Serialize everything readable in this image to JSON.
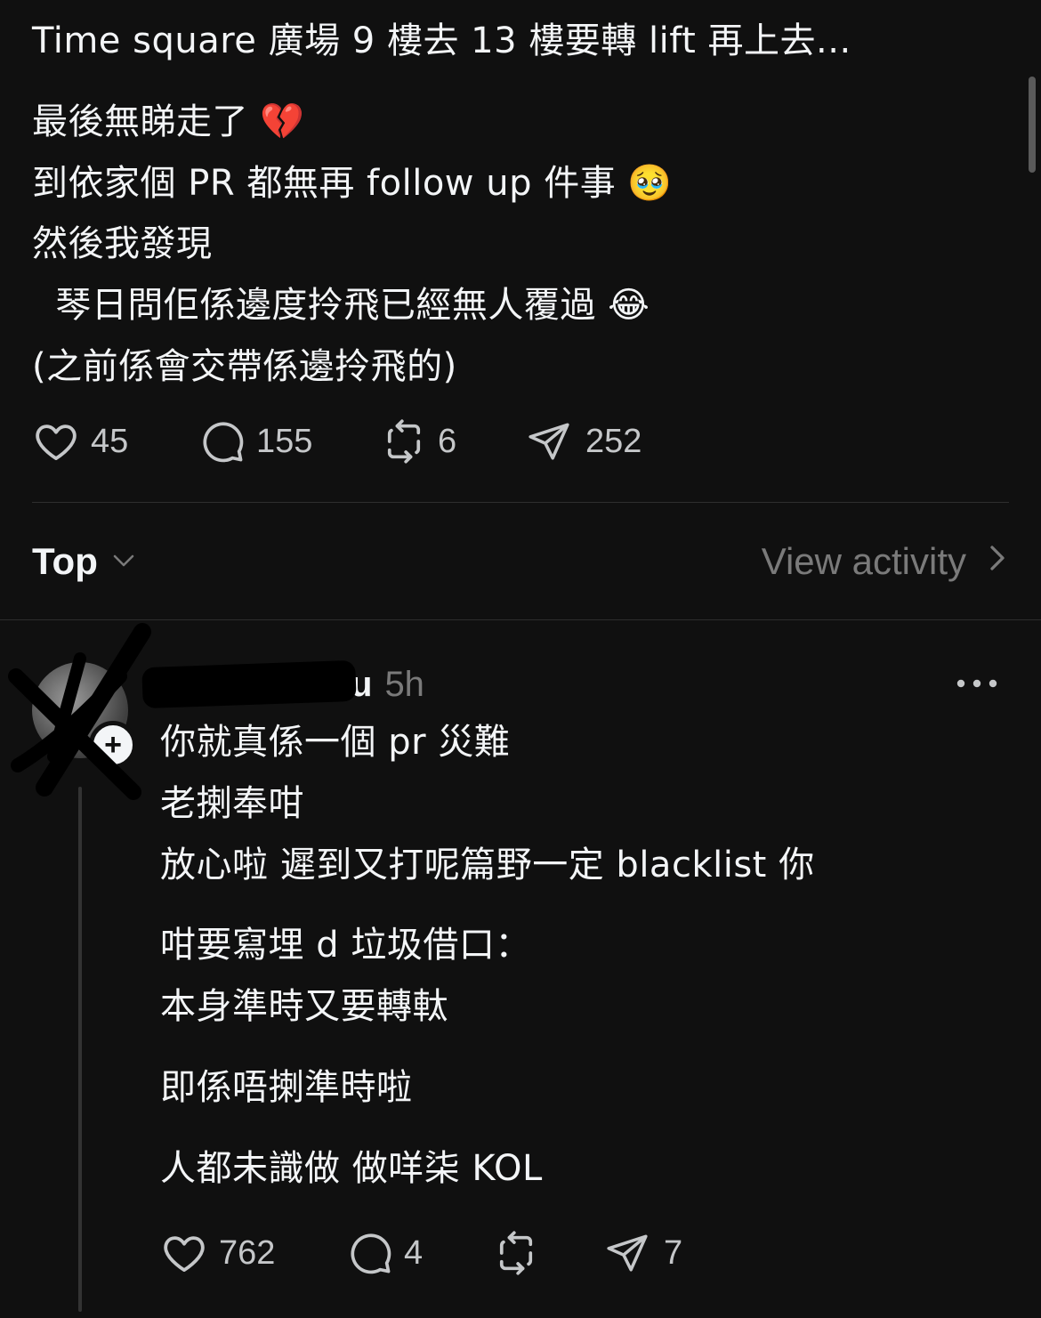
{
  "post": {
    "lines": [
      "Time square 廣場 9 樓去 13 樓要轉 lift 再上去...",
      "最後無睇走了 💔",
      "到依家個 PR 都無再 follow up 件事 🥹",
      "然後我發現",
      "  琴日問佢係邊度拎飛已經無人覆過 😂",
      "(之前係會交帶係邊拎飛的)"
    ],
    "actions": {
      "likes": "45",
      "comments": "155",
      "reposts": "6",
      "shares": "252"
    }
  },
  "sort": {
    "label": "Top",
    "view_activity": "View activity"
  },
  "reply": {
    "username_visible": "u",
    "time": "5h",
    "avatar_badge": "+",
    "lines": [
      "你就真係一個 pr 災難",
      "老揦奉咁",
      "放心啦 遲到又打呢篇野一定 blacklist 你",
      "咁要寫埋 d 垃圾借口：",
      "本身準時又要轉軚",
      "即係唔揦準時啦",
      "人都未識做 做咩柒 KOL"
    ],
    "actions": {
      "likes": "762",
      "comments": "4",
      "reposts": "",
      "shares": "7"
    }
  },
  "icons": {
    "like": "heart-icon",
    "comment": "comment-bubble-icon",
    "repost": "repost-icon",
    "share": "paper-plane-icon",
    "sort": "chevron-down-icon",
    "activity": "chevron-right-icon",
    "more": "more-dots-icon"
  },
  "colors": {
    "background": "#101010",
    "text": "#f3f5f7",
    "muted": "#7a7a7a",
    "divider": "#2e2e2e"
  }
}
